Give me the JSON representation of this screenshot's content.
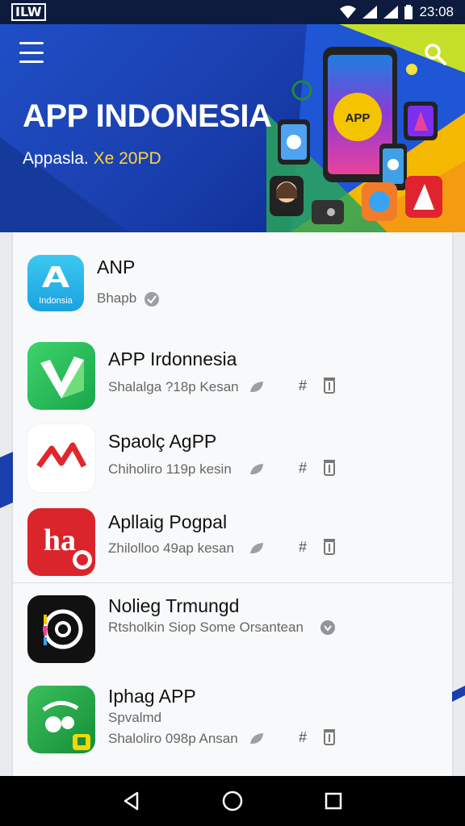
{
  "status_bar": {
    "left_label": "ILW",
    "time": "23:08"
  },
  "header": {
    "title": "APP INDONESIA",
    "subtitle_prefix": "Appasla. ",
    "subtitle_accent": "Xe 20PD",
    "hero_badge": "APP"
  },
  "apps": [
    {
      "name": "ANP",
      "meta": "Bhapb",
      "icon_label": "Indonsia"
    },
    {
      "name": "APP Irdonnesia",
      "meta": "Shalalga ?18p Kesan"
    },
    {
      "name": "Spaolç AgPP",
      "meta": "Chiholiro 119p kesin"
    },
    {
      "name": "Apllaig Pogpal",
      "meta": "Zhilolloo 49ap kesan",
      "icon_label": "ha"
    },
    {
      "name": "Nolieg Trmungd",
      "meta": "Rtsholkin Siop Some Orsantean"
    },
    {
      "name": "Iphag APP",
      "meta_line1": "Spvalmd",
      "meta": "Shaloliro 098p Ansan"
    }
  ],
  "colors": {
    "header_blue": "#1a3fae",
    "accent_yellow": "#ffd43b",
    "status_bar": "#0d1b3e"
  }
}
